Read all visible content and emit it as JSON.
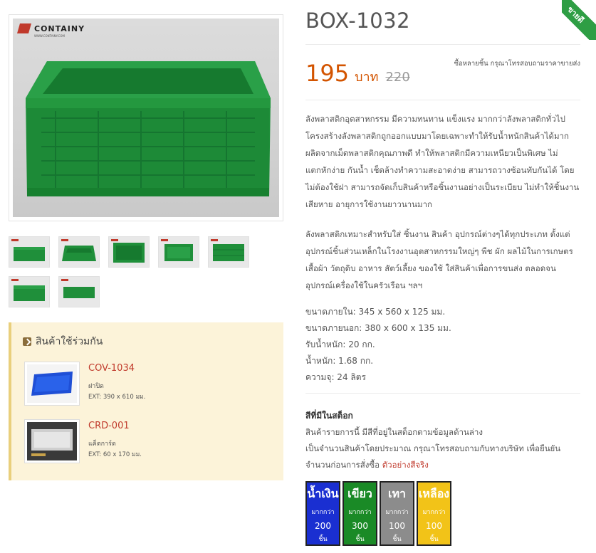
{
  "product": {
    "title": "BOX-1032",
    "price": "195",
    "price_unit": "บาท",
    "old_price": "220",
    "wholesale_note": "ซื้อหลายชิ้น กรุณาโทรสอบถามราคาขายส่ง",
    "ribbon": "ขายดี",
    "brand": "CONTAINY",
    "brand_sub": "WWW.CONTAINY.COM"
  },
  "description": [
    "ลังพลาสติกอุตสาหกรรม มีความทนทาน แข็งแรง มากกว่าลังพลาสติกทั่วไป โครงสร้างลังพลาสติกถูกออกแบบมาโดยเฉพาะทำให้รับน้ำหนักสินค้าได้มาก ผลิตจากเม็ดพลาสติกคุณภาพดี ทำให้พลาสติกมีความเหนียวเป็นพิเศษ ไม่แตกหักง่าย กันน้ำ เช็ดล้างทำความสะอาดง่าย สามารถวางซ้อนทับกันได้ โดยไม่ต้องใช้ฝา สามารถจัดเก็บสินค้าหรือชิ้นงานอย่างเป็นระเบียบ ไม่ทำให้ชิ้นงานเสียหาย อายุการใช้งานยาวนานมาก",
    "ลังพลาสติกเหมาะสำหรับใส่ ชิ้นงาน สินค้า อุปกรณ์ต่างๆได้ทุกประเภท ตั้งแต่อุปกรณ์ชิ้นส่วนเหล็กในโรงงานอุตสาหกรรมใหญ่ๆ พืช ผัก ผลไม้ในการเกษตร เสื้อผ้า วัตถุดิบ อาหาร สัตว์เลี้ยง ของใช้ ใส่สินค้าเพื่อการขนส่ง ตลอดจนอุปกรณ์เครื่องใช้ในครัวเรือน ฯลฯ"
  ],
  "specs": [
    "ขนาดภายใน: 345 x 560 x 125 มม.",
    "ขนาดภายนอก: 380 x 600 x 135 มม.",
    "รับน้ำหนัก: 20 กก.",
    "น้ำหนัก: 1.68 กก.",
    "ความจุ: 24 ลิตร"
  ],
  "stock": {
    "title": "สีที่มีในสต็อก",
    "line1": "สินค้ารายการนี้ มีสีที่อยู่ในสต็อกตามข้อมูลด้านล่าง",
    "line2": "เป็นจำนวนสินค้าโดยประมาณ กรุณาโทรสอบถามกับทางบริษัท เพื่อยืนยันจำนวนก่อนการสั่งซื้อ",
    "link": "ตัวอย่างสีจริง"
  },
  "colors": [
    {
      "name": "น้ำเงิน",
      "more": "มากกว่า",
      "count": "200",
      "unit": "ชิ้น",
      "bg": "#1a2fd1",
      "fg": "#ffffff"
    },
    {
      "name": "เขียว",
      "more": "มากกว่า",
      "count": "300",
      "unit": "ชิ้น",
      "bg": "#1a8a26",
      "fg": "#ffffff"
    },
    {
      "name": "เทา",
      "more": "มากกว่า",
      "count": "100",
      "unit": "ชิ้น",
      "bg": "#8c8c8c",
      "fg": "#ffffff"
    },
    {
      "name": "เหลือง",
      "more": "มากกว่า",
      "count": "100",
      "unit": "ชิ้น",
      "bg": "#f2c318",
      "fg": "#ffffff"
    }
  ],
  "related": {
    "title": "สินค้าใช้ร่วมกัน",
    "items": [
      {
        "code": "COV-1034",
        "name": "ฝาปิด",
        "ext": "EXT: 390 x 610 มม."
      },
      {
        "code": "CRD-001",
        "name": "แค็ตการ์ด",
        "ext": "EXT: 60 x 170 มม."
      }
    ]
  }
}
